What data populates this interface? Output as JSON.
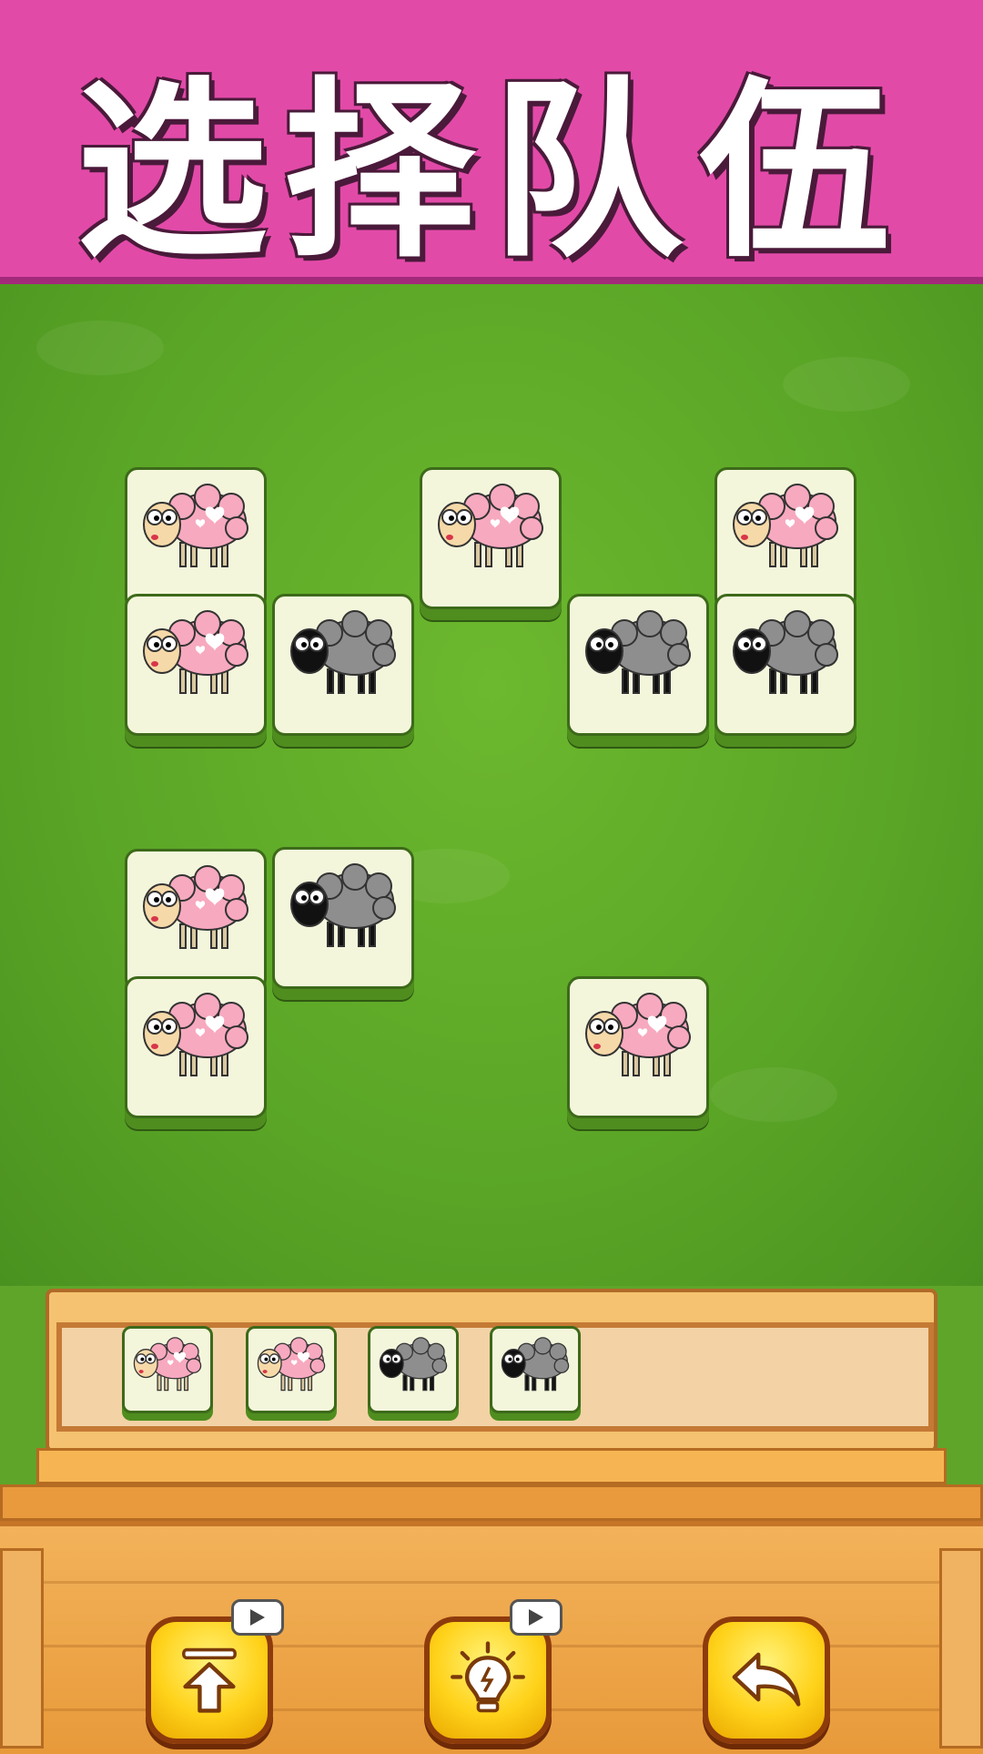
{
  "header": {
    "title": "选择队伍"
  },
  "board": {
    "tiles": [
      {
        "type": "pink"
      },
      {
        "type": "pink"
      },
      {
        "type": "pink"
      },
      {
        "type": "pink"
      },
      {
        "type": "gray"
      },
      {
        "type": "gray"
      },
      {
        "type": "gray"
      },
      {
        "type": "pink"
      },
      {
        "type": "gray"
      },
      {
        "type": "pink"
      },
      {
        "type": "pink"
      }
    ]
  },
  "tray": {
    "slots": [
      {
        "type": "pink"
      },
      {
        "type": "pink"
      },
      {
        "type": "gray"
      },
      {
        "type": "gray"
      }
    ],
    "capacity": 7
  },
  "controls": {
    "buttons": [
      {
        "name": "move-up-button",
        "icon": "arrow-up-icon",
        "has_video_badge": true
      },
      {
        "name": "hint-button",
        "icon": "lightbulb-icon",
        "has_video_badge": true
      },
      {
        "name": "undo-button",
        "icon": "undo-arrow-icon",
        "has_video_badge": false
      }
    ]
  },
  "colors": {
    "banner": "#e24aa8",
    "grass": "#5fa52a",
    "tile_face": "#f4f6dc",
    "button": "#ffd21a"
  }
}
